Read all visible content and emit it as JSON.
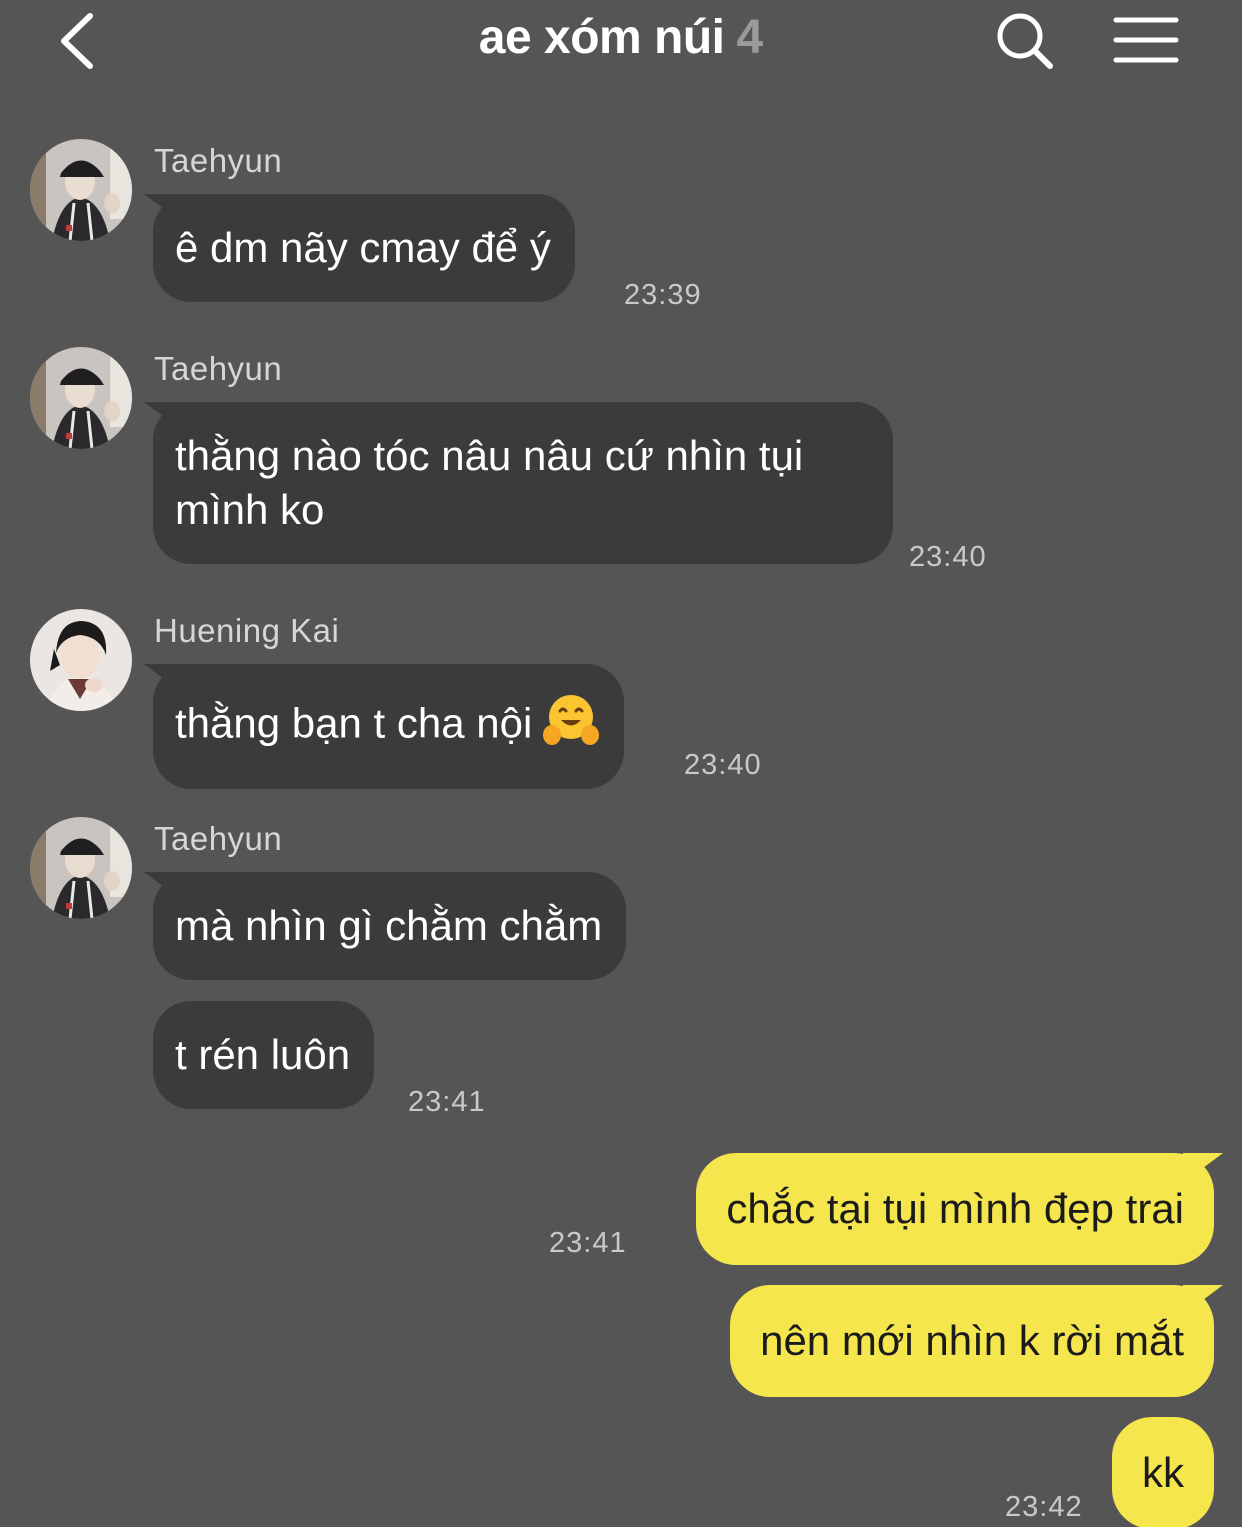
{
  "header": {
    "title": "ae xóm núi",
    "member_count": "4",
    "back_icon": "chevron-left-icon",
    "search_icon": "search-icon",
    "menu_icon": "hamburger-menu-icon"
  },
  "colors": {
    "background": "#555556",
    "incoming_bubble": "#3b3b3c",
    "outgoing_bubble": "#f6e64e",
    "outgoing_text": "#1b1b1b"
  },
  "messages": [
    {
      "sender": "Taehyun",
      "text": "ê dm nãy cmay để ý",
      "time": "23:39"
    },
    {
      "sender": "Taehyun",
      "text_line1": "thằng nào tóc nâu nâu cứ nhìn tụi",
      "text_line2": "mình ko",
      "time": "23:40"
    },
    {
      "sender": "Huening Kai",
      "text": "thằng bạn t cha nội",
      "emoji": "hugging-face-emoji",
      "time": "23:40"
    },
    {
      "sender": "Taehyun",
      "text": "mà nhìn gì chằm chằm"
    },
    {
      "text": "t rén luôn",
      "time": "23:41"
    }
  ],
  "outgoing": [
    {
      "text": "chắc tại tụi mình đẹp trai",
      "time": "23:41"
    },
    {
      "text": "nên mới nhìn k rời mắt"
    },
    {
      "text": "kk",
      "time": "23:42"
    }
  ]
}
